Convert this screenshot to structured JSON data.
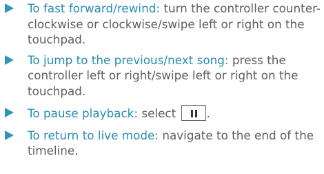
{
  "items": [
    {
      "lead": "To fast forward/rewind:",
      "text": " turn the controller counter-clockwise or clockwise/swipe left or right on the touchpad."
    },
    {
      "lead": "To jump to the previous/next song:",
      "text": " press the controller left or right/swipe left or right on the touchpad."
    },
    {
      "lead": "To pause playback:",
      "text_before": " select ",
      "button_icon": "pause-icon",
      "text_after": "."
    },
    {
      "lead": "To return to live mode:",
      "text": " navigate to the end of the timeline."
    }
  ],
  "colors": {
    "accent": "#2a8db4",
    "bullet": "#2e96bb",
    "body_text": "#5f5f5f",
    "icon_border": "#666666"
  }
}
